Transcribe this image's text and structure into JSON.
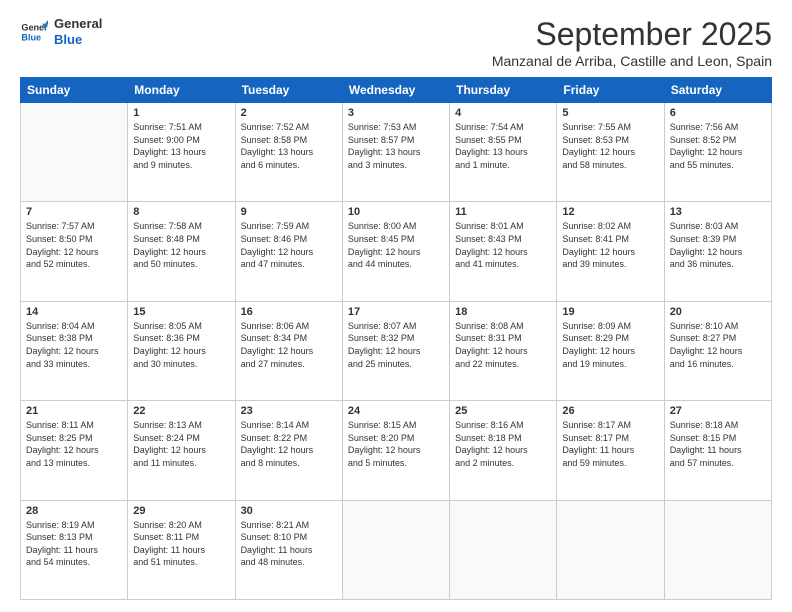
{
  "logo": {
    "line1": "General",
    "line2": "Blue",
    "icon_color": "#1a7fc1"
  },
  "title": "September 2025",
  "subtitle": "Manzanal de Arriba, Castille and Leon, Spain",
  "weekdays": [
    "Sunday",
    "Monday",
    "Tuesday",
    "Wednesday",
    "Thursday",
    "Friday",
    "Saturday"
  ],
  "weeks": [
    [
      {
        "day": "",
        "info": ""
      },
      {
        "day": "1",
        "info": "Sunrise: 7:51 AM\nSunset: 9:00 PM\nDaylight: 13 hours\nand 9 minutes."
      },
      {
        "day": "2",
        "info": "Sunrise: 7:52 AM\nSunset: 8:58 PM\nDaylight: 13 hours\nand 6 minutes."
      },
      {
        "day": "3",
        "info": "Sunrise: 7:53 AM\nSunset: 8:57 PM\nDaylight: 13 hours\nand 3 minutes."
      },
      {
        "day": "4",
        "info": "Sunrise: 7:54 AM\nSunset: 8:55 PM\nDaylight: 13 hours\nand 1 minute."
      },
      {
        "day": "5",
        "info": "Sunrise: 7:55 AM\nSunset: 8:53 PM\nDaylight: 12 hours\nand 58 minutes."
      },
      {
        "day": "6",
        "info": "Sunrise: 7:56 AM\nSunset: 8:52 PM\nDaylight: 12 hours\nand 55 minutes."
      }
    ],
    [
      {
        "day": "7",
        "info": "Sunrise: 7:57 AM\nSunset: 8:50 PM\nDaylight: 12 hours\nand 52 minutes."
      },
      {
        "day": "8",
        "info": "Sunrise: 7:58 AM\nSunset: 8:48 PM\nDaylight: 12 hours\nand 50 minutes."
      },
      {
        "day": "9",
        "info": "Sunrise: 7:59 AM\nSunset: 8:46 PM\nDaylight: 12 hours\nand 47 minutes."
      },
      {
        "day": "10",
        "info": "Sunrise: 8:00 AM\nSunset: 8:45 PM\nDaylight: 12 hours\nand 44 minutes."
      },
      {
        "day": "11",
        "info": "Sunrise: 8:01 AM\nSunset: 8:43 PM\nDaylight: 12 hours\nand 41 minutes."
      },
      {
        "day": "12",
        "info": "Sunrise: 8:02 AM\nSunset: 8:41 PM\nDaylight: 12 hours\nand 39 minutes."
      },
      {
        "day": "13",
        "info": "Sunrise: 8:03 AM\nSunset: 8:39 PM\nDaylight: 12 hours\nand 36 minutes."
      }
    ],
    [
      {
        "day": "14",
        "info": "Sunrise: 8:04 AM\nSunset: 8:38 PM\nDaylight: 12 hours\nand 33 minutes."
      },
      {
        "day": "15",
        "info": "Sunrise: 8:05 AM\nSunset: 8:36 PM\nDaylight: 12 hours\nand 30 minutes."
      },
      {
        "day": "16",
        "info": "Sunrise: 8:06 AM\nSunset: 8:34 PM\nDaylight: 12 hours\nand 27 minutes."
      },
      {
        "day": "17",
        "info": "Sunrise: 8:07 AM\nSunset: 8:32 PM\nDaylight: 12 hours\nand 25 minutes."
      },
      {
        "day": "18",
        "info": "Sunrise: 8:08 AM\nSunset: 8:31 PM\nDaylight: 12 hours\nand 22 minutes."
      },
      {
        "day": "19",
        "info": "Sunrise: 8:09 AM\nSunset: 8:29 PM\nDaylight: 12 hours\nand 19 minutes."
      },
      {
        "day": "20",
        "info": "Sunrise: 8:10 AM\nSunset: 8:27 PM\nDaylight: 12 hours\nand 16 minutes."
      }
    ],
    [
      {
        "day": "21",
        "info": "Sunrise: 8:11 AM\nSunset: 8:25 PM\nDaylight: 12 hours\nand 13 minutes."
      },
      {
        "day": "22",
        "info": "Sunrise: 8:13 AM\nSunset: 8:24 PM\nDaylight: 12 hours\nand 11 minutes."
      },
      {
        "day": "23",
        "info": "Sunrise: 8:14 AM\nSunset: 8:22 PM\nDaylight: 12 hours\nand 8 minutes."
      },
      {
        "day": "24",
        "info": "Sunrise: 8:15 AM\nSunset: 8:20 PM\nDaylight: 12 hours\nand 5 minutes."
      },
      {
        "day": "25",
        "info": "Sunrise: 8:16 AM\nSunset: 8:18 PM\nDaylight: 12 hours\nand 2 minutes."
      },
      {
        "day": "26",
        "info": "Sunrise: 8:17 AM\nSunset: 8:17 PM\nDaylight: 11 hours\nand 59 minutes."
      },
      {
        "day": "27",
        "info": "Sunrise: 8:18 AM\nSunset: 8:15 PM\nDaylight: 11 hours\nand 57 minutes."
      }
    ],
    [
      {
        "day": "28",
        "info": "Sunrise: 8:19 AM\nSunset: 8:13 PM\nDaylight: 11 hours\nand 54 minutes."
      },
      {
        "day": "29",
        "info": "Sunrise: 8:20 AM\nSunset: 8:11 PM\nDaylight: 11 hours\nand 51 minutes."
      },
      {
        "day": "30",
        "info": "Sunrise: 8:21 AM\nSunset: 8:10 PM\nDaylight: 11 hours\nand 48 minutes."
      },
      {
        "day": "",
        "info": ""
      },
      {
        "day": "",
        "info": ""
      },
      {
        "day": "",
        "info": ""
      },
      {
        "day": "",
        "info": ""
      }
    ]
  ]
}
